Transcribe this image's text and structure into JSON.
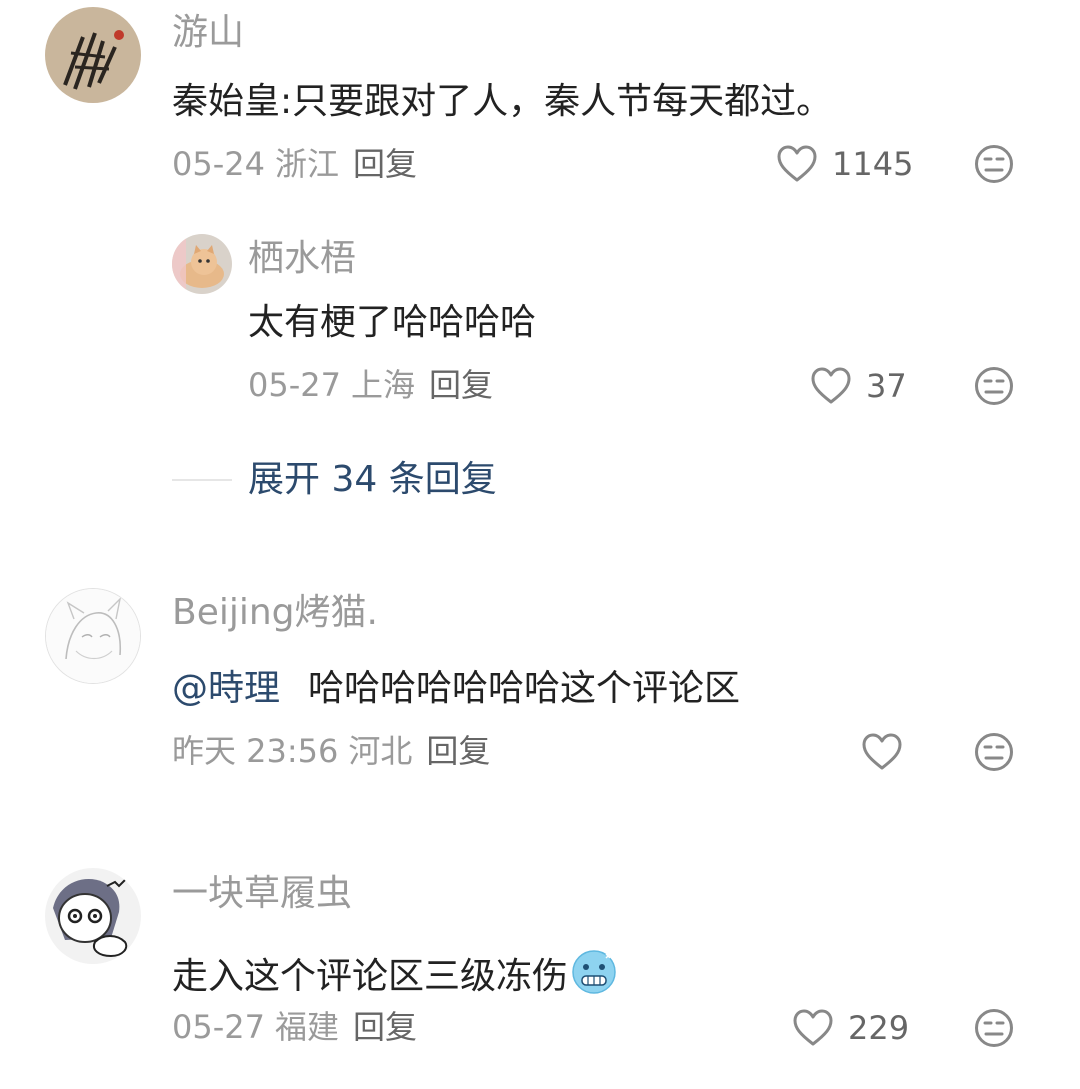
{
  "colors": {
    "text": "#222222",
    "meta": "#9a9a9a",
    "link": "#2c4a6d",
    "icon": "#888888"
  },
  "comments": [
    {
      "username": "游山",
      "content": "秦始皇:只要跟对了人，秦人节每天都过。",
      "date": "05-24",
      "location": "浙江",
      "reply_label": "回复",
      "likes": "1145",
      "avatar_icon": "ink-painting-avatar",
      "replies": [
        {
          "username": "栖水梧",
          "content": "太有梗了哈哈哈哈",
          "date": "05-27",
          "location": "上海",
          "reply_label": "回复",
          "likes": "37",
          "avatar_icon": "cat-avatar"
        }
      ],
      "expand_label": "展开 34 条回复"
    },
    {
      "username": "Beijing烤猫.",
      "mention": "@時理",
      "content": "哈哈哈哈哈哈哈这个评论区",
      "date": "昨天 23:56",
      "location": "河北",
      "reply_label": "回复",
      "likes": "",
      "avatar_icon": "sketch-avatar"
    },
    {
      "username": "一块草履虫",
      "content": "走入这个评论区三级冻伤",
      "emoji": "cold-face-emoji",
      "date": "05-27",
      "location": "福建",
      "reply_label": "回复",
      "likes": "229",
      "avatar_icon": "cartoon-avatar"
    }
  ],
  "icons": {
    "like": "heart-outline-icon",
    "dislike": "meh-face-icon"
  }
}
